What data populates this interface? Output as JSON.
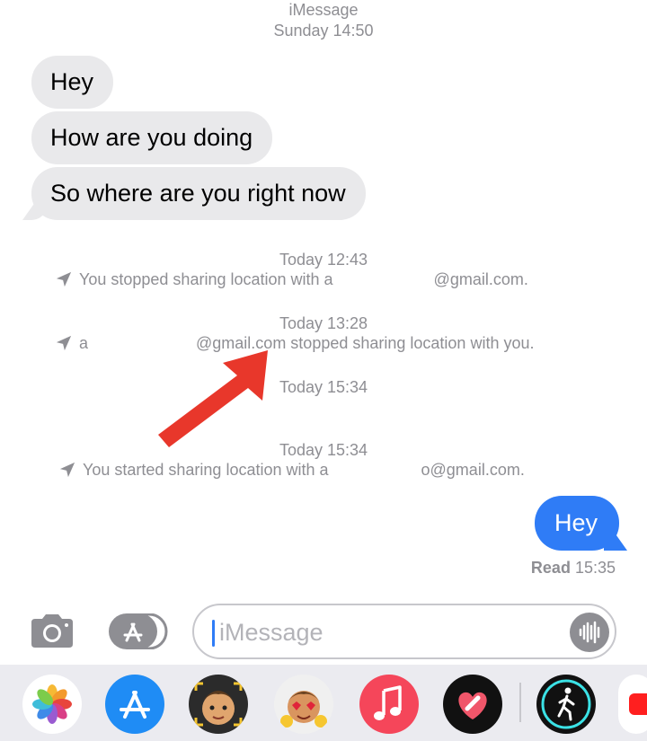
{
  "header": {
    "service": "iMessage",
    "date": "Sunday 14:50"
  },
  "incoming": [
    {
      "text": "Hey"
    },
    {
      "text": "How are you doing"
    },
    {
      "text": "So where are you right now"
    }
  ],
  "events": [
    {
      "time": "Today 12:43",
      "text_start": "You stopped sharing location with a",
      "text_end": "@gmail.com."
    },
    {
      "time": "Today 13:28",
      "text_start": "a",
      "text_end": "@gmail.com stopped sharing location with you."
    },
    {
      "time": "Today 15:34"
    },
    {
      "time": "Today 15:34",
      "text_start": "You started sharing location with a",
      "text_end": "o@gmail.com."
    }
  ],
  "outgoing": [
    {
      "text": "Hey"
    }
  ],
  "read_receipt": {
    "label": "Read",
    "time": "15:35"
  },
  "input": {
    "placeholder": "iMessage"
  },
  "icons": {
    "camera": "camera-icon",
    "appstore": "app-store-icon",
    "mic": "audio-waveform-icon",
    "location": "location-arrow-icon",
    "annotation": "red-arrow-annotation"
  },
  "drawer_apps": [
    {
      "name": "photos"
    },
    {
      "name": "app-store"
    },
    {
      "name": "memoji"
    },
    {
      "name": "animoji"
    },
    {
      "name": "music"
    },
    {
      "name": "digital-touch"
    },
    {
      "name": "fitness"
    },
    {
      "name": "more"
    }
  ],
  "colors": {
    "bubble_in": "#e9e9eb",
    "bubble_out": "#2f7cf6",
    "meta": "#8e8e93",
    "annotation": "#e8372b"
  }
}
